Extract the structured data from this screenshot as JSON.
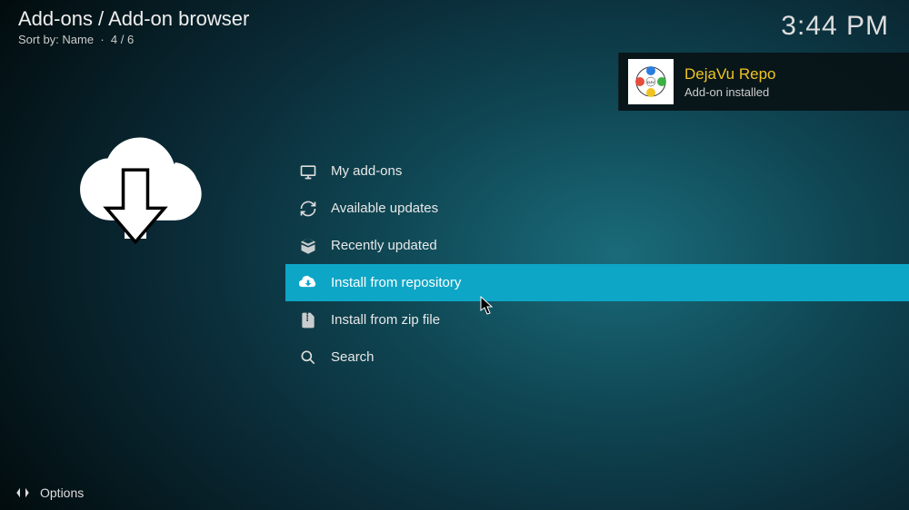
{
  "header": {
    "breadcrumb": "Add-ons / Add-on browser",
    "sort_prefix": "Sort by: ",
    "sort_value": "Name",
    "position": "4 / 6"
  },
  "clock": "3:44 PM",
  "toast": {
    "title": "DejaVu Repo",
    "subtitle": "Add-on installed",
    "icon_name": "dejavu-repo-icon"
  },
  "menu": {
    "items": [
      {
        "label": "My add-ons",
        "icon": "tv-icon",
        "selected": false
      },
      {
        "label": "Available updates",
        "icon": "refresh-icon",
        "selected": false
      },
      {
        "label": "Recently updated",
        "icon": "box-open-icon",
        "selected": false
      },
      {
        "label": "Install from repository",
        "icon": "cloud-download-icon",
        "selected": true
      },
      {
        "label": "Install from zip file",
        "icon": "zip-file-icon",
        "selected": false
      },
      {
        "label": "Search",
        "icon": "search-icon",
        "selected": false
      }
    ]
  },
  "footer": {
    "options_label": "Options"
  },
  "colors": {
    "accent": "#0ea6c6",
    "toast_title": "#f0c420"
  }
}
